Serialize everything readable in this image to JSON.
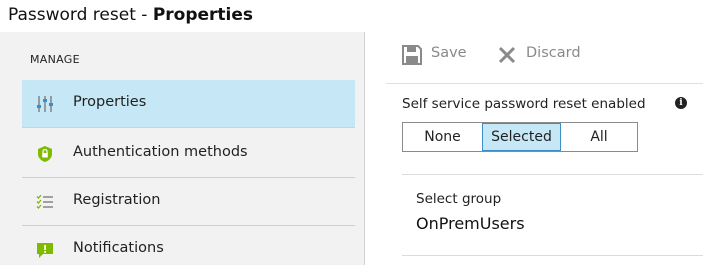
{
  "window": {
    "title_prefix": "Password reset - ",
    "title_main": "Properties"
  },
  "sidebar": {
    "section_header": "MANAGE",
    "items": [
      {
        "label": "Properties",
        "icon": "properties-sliders-icon",
        "selected": true
      },
      {
        "label": "Authentication methods",
        "icon": "shield-icon",
        "selected": false
      },
      {
        "label": "Registration",
        "icon": "checklist-icon",
        "selected": false
      },
      {
        "label": "Notifications",
        "icon": "notification-speech-icon",
        "selected": false
      }
    ]
  },
  "toolbar": {
    "save_label": "Save",
    "save_icon": "save-disk-icon",
    "discard_label": "Discard",
    "discard_icon": "discard-x-icon"
  },
  "main": {
    "sspr_label": "Self service password reset enabled",
    "info_icon": "info-icon",
    "options": [
      "None",
      "Selected",
      "All"
    ],
    "selected_option": "Selected",
    "group_label": "Select group",
    "group_value": "OnPremUsers"
  },
  "colors": {
    "selected_background": "#c6e8f6",
    "selected_border": "#3c8fc6",
    "sidebar_background": "#f2f2f2",
    "shield_green": "#7fba00",
    "disabled_text": "#8a8a8a"
  }
}
